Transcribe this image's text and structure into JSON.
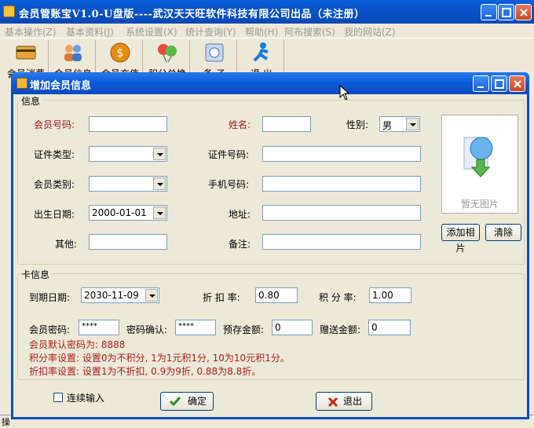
{
  "main_window": {
    "title": "会员管账宝V1.0-U盘版----武汉天天旺软件科技有限公司出品（未注册）"
  },
  "menu": [
    "基本操作(Z)",
    "基本资料(J)",
    "系统设置(X)",
    "统计查询(Y)",
    "帮助(H)",
    "阿布搜索(S)",
    "我的网站(Z)"
  ],
  "toolbar": [
    "会员消费",
    "会员信息",
    "会员充值",
    "积分兑换",
    "备 子",
    "退 出"
  ],
  "status_left": "操",
  "dialog": {
    "title": "增加会员信息",
    "info_group": "信息",
    "card_group": "卡信息",
    "fields": {
      "member_no_label": "会员号码:",
      "name_label": "姓名:",
      "gender_label": "性别:",
      "gender_value": "男",
      "id_type_label": "证件类型:",
      "id_no_label": "证件号码:",
      "member_type_label": "会员类别:",
      "mobile_label": "手机号码:",
      "birth_label": "出生日期:",
      "birth_value": "2000-01-01",
      "address_label": "地址:",
      "other_label": "其他:",
      "remark_label": "备注:"
    },
    "photo": {
      "caption": "暂无图片",
      "add_button": "添加相片",
      "clear_button": "清除"
    },
    "card": {
      "expire_label": "到期日期:",
      "expire_value": "2030-11-09",
      "discount_label": "折 扣 率:",
      "discount_value": "0.80",
      "points_label": "积 分 率:",
      "points_value": "1.00",
      "password_label": "会员密码:",
      "password_value": "****",
      "confirm_label": "密码确认:",
      "confirm_value": "****",
      "deposit_label": "预存金额:",
      "deposit_value": "0",
      "gift_label": "赠送金额:",
      "gift_value": "0"
    },
    "notes": [
      "会员默认密码为: 8888",
      "积分率设置: 设置0为不积分, 1为1元积1分, 10为10元积1分。",
      "折扣率设置: 设置1为不折扣, 0.9为9折, 0.88为8.8折。"
    ],
    "continuous_input_label": "连续输入",
    "ok_button": "确定",
    "exit_button": "退出"
  },
  "colors": {
    "titlebar_blue": "#0a5fd8",
    "required_label_red": "#a01818",
    "note_red": "#b01c1c",
    "window_bg": "#ece9d8"
  }
}
